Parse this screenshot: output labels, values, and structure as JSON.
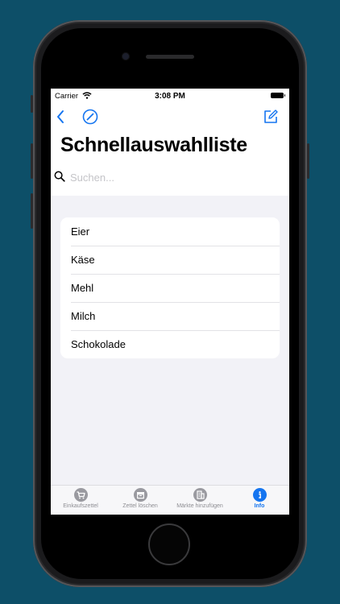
{
  "status_bar": {
    "carrier": "Carrier",
    "time": "3:08 PM"
  },
  "nav": {
    "back_icon": "chevron-left-icon",
    "compass_icon": "compass-icon",
    "compose_icon": "compose-icon"
  },
  "page": {
    "title": "Schnellauswahlliste"
  },
  "search": {
    "placeholder": "Suchen...",
    "value": ""
  },
  "list": {
    "items": [
      {
        "label": "Eier"
      },
      {
        "label": "Käse"
      },
      {
        "label": "Mehl"
      },
      {
        "label": "Milch"
      },
      {
        "label": "Schokolade"
      }
    ]
  },
  "tabs": [
    {
      "label": "Einkaufszettel",
      "icon": "cart-icon",
      "active": false
    },
    {
      "label": "Zettel löschen",
      "icon": "archive-icon",
      "active": false
    },
    {
      "label": "Märkte hinzufügen",
      "icon": "building-icon",
      "active": false
    },
    {
      "label": "Info",
      "icon": "info-icon",
      "active": true
    }
  ],
  "colors": {
    "background": "#0d4f68",
    "accent": "#1575f0",
    "inactive_tab": "#9a9aa0"
  }
}
